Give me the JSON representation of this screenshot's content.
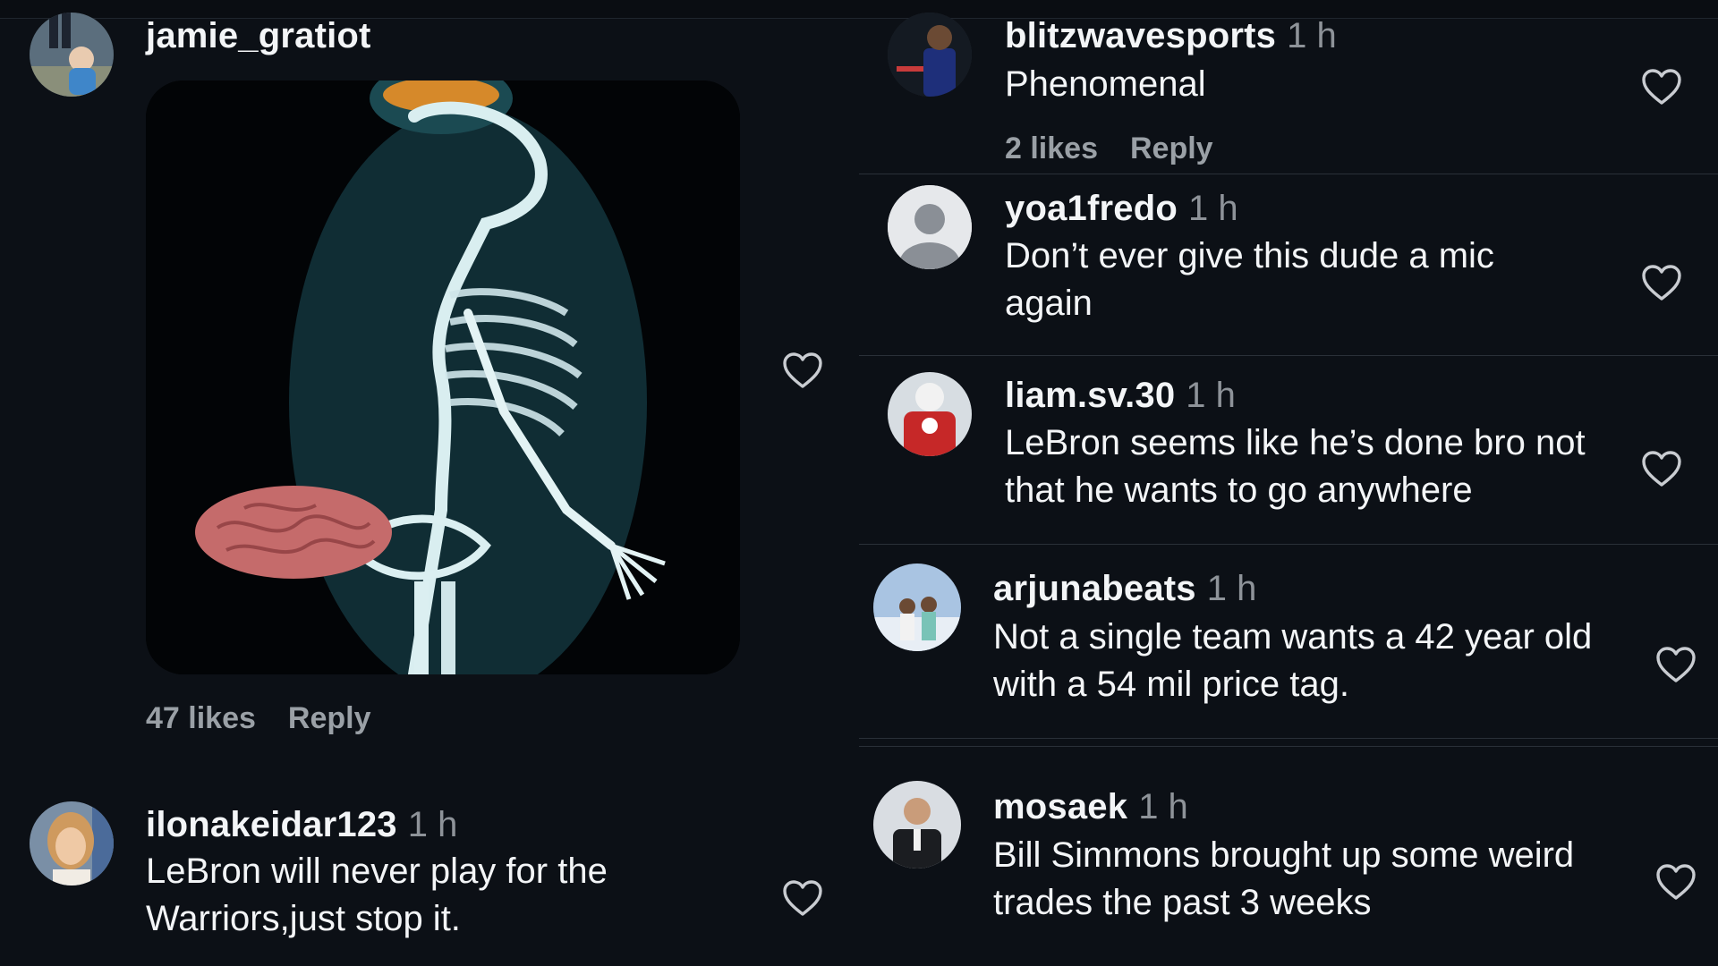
{
  "left": {
    "post": {
      "username": "jamie_gratiot",
      "likes": "47 likes",
      "reply": "Reply"
    },
    "comment": {
      "username": "ilonakeidar123",
      "time": "1 h",
      "text": "LeBron will never play for the Warriors,just stop it."
    }
  },
  "right": {
    "comments": [
      {
        "username": "blitzwavesports",
        "time": "1 h",
        "text": "Phenomenal",
        "likes": "2 likes",
        "reply": "Reply"
      },
      {
        "username": "yoa1fredo",
        "time": "1 h",
        "text": "Don’t ever give this dude a mic again"
      },
      {
        "username": "liam.sv.30",
        "time": "1 h",
        "text": "LeBron seems like he’s done bro not that he wants to go anywhere"
      },
      {
        "username": "arjunabeats",
        "time": "1 h",
        "text": "Not a single team wants a 42 year old with a 54 mil price tag."
      },
      {
        "username": "mosaek",
        "time": "1 h",
        "text": "Bill Simmons brought up some weird trades the past 3 weeks"
      }
    ]
  },
  "icons": {
    "heart": "heart-outline-icon",
    "avatar_placeholder": "default-user-icon"
  },
  "colors": {
    "background": "#0c1016",
    "text": "#f3f5f7",
    "secondary": "#8e9399"
  }
}
